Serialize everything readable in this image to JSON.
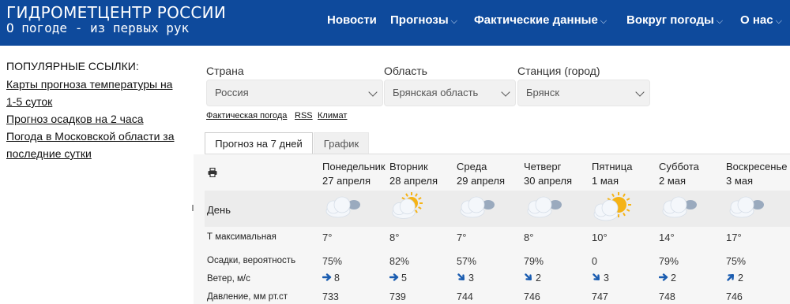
{
  "header": {
    "title": "ГИДРОМЕТЦЕНТР РОССИИ",
    "subtitle": "О погоде - из первых рук",
    "nav": [
      {
        "label": "Новости",
        "chevron": false
      },
      {
        "label": "Прогнозы",
        "chevron": true
      },
      {
        "label": "Фактические данные",
        "chevron": true
      },
      {
        "label": "Вокруг погоды",
        "chevron": true
      },
      {
        "label": "О нас",
        "chevron": true
      }
    ]
  },
  "sidebar": {
    "title": "ПОПУЛЯРНЫЕ ССЫЛКИ:",
    "links": [
      "Карты прогноза температуры на 1-5 суток",
      "Прогноз осадков на 2 часа",
      "Погода в Московской области за последние сутки"
    ]
  },
  "filters": {
    "country": {
      "label": "Страна",
      "value": "Россия"
    },
    "region": {
      "label": "Область",
      "value": "Брянская область"
    },
    "station": {
      "label": "Станция (город)",
      "value": "Брянск"
    }
  },
  "quick_links": [
    "Фактическая погода",
    "RSS",
    "Климат"
  ],
  "tabs": {
    "active": "Прогноз на 7 дней",
    "inactive": "График"
  },
  "forecast": {
    "row_labels": {
      "day": "День",
      "tmax": "Т максимальная",
      "precip": "Осадки, вероятность",
      "wind": "Ветер, м/с",
      "pressure": "Давление, мм рт.ст"
    },
    "days": [
      {
        "name": "Понедельник",
        "date": "27 апреля",
        "icon": "cloud-rain-icon",
        "tmax": "7°",
        "precip": "75%",
        "wind": "8",
        "wind_dir": "east",
        "pressure": "733"
      },
      {
        "name": "Вторник",
        "date": "28 апреля",
        "icon": "partly-cloudy-rain-icon",
        "tmax": "8°",
        "precip": "82%",
        "wind": "5",
        "wind_dir": "east",
        "pressure": "739"
      },
      {
        "name": "Среда",
        "date": "29 апреля",
        "icon": "cloud-rain-icon",
        "tmax": "7°",
        "precip": "57%",
        "wind": "3",
        "wind_dir": "southeast",
        "pressure": "744"
      },
      {
        "name": "Четверг",
        "date": "30 апреля",
        "icon": "cloud-rain-icon",
        "tmax": "8°",
        "precip": "79%",
        "wind": "2",
        "wind_dir": "southeast",
        "pressure": "746"
      },
      {
        "name": "Пятница",
        "date": "1 мая",
        "icon": "partly-sunny-icon",
        "tmax": "10°",
        "precip": "0",
        "wind": "3",
        "wind_dir": "southeast",
        "pressure": "747"
      },
      {
        "name": "Суббота",
        "date": "2 мая",
        "icon": "cloud-rain-icon",
        "tmax": "14°",
        "precip": "79%",
        "wind": "2",
        "wind_dir": "east",
        "pressure": "748"
      },
      {
        "name": "Воскресенье",
        "date": "3 мая",
        "icon": "cloud-rain-icon",
        "tmax": "17°",
        "precip": "75%",
        "wind": "2",
        "wind_dir": "northeast",
        "pressure": "746"
      }
    ]
  },
  "colors": {
    "header_bg": "#0e4a9c",
    "wind_arrow": "#1a5cb0",
    "sun": "#f5b316"
  }
}
